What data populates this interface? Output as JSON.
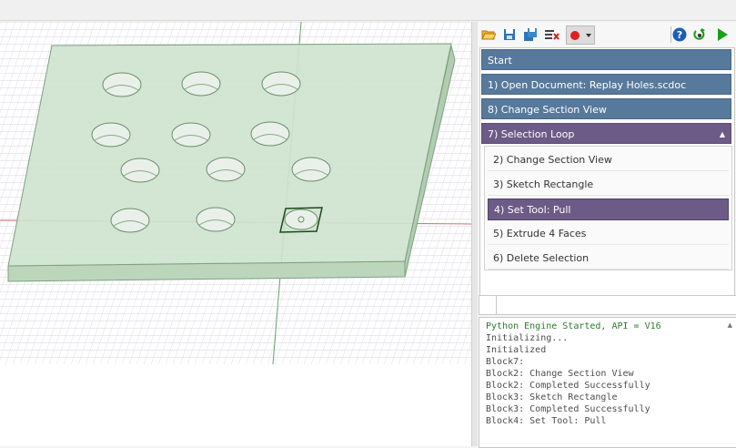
{
  "toolbar": {
    "icons": [
      "open-folder-icon",
      "save-icon",
      "save-as-icon",
      "clear-icon",
      "record-icon",
      "dropdown-icon",
      "help-icon",
      "debug-icon",
      "run-icon"
    ],
    "colors": {
      "record": "#e02020",
      "run": "#18a018",
      "help": "#1a5fb4"
    }
  },
  "steps": {
    "start": "Start",
    "open_document": "1) Open Document: Replay Holes.scdoc",
    "change_section_view": "8) Change Section View",
    "selection_loop": "7) Selection Loop",
    "selection_loop_caret": "▲"
  },
  "substeps": [
    {
      "label": "2) Change Section View",
      "selected": false
    },
    {
      "label": "3) Sketch Rectangle",
      "selected": false
    },
    {
      "label": "4) Set Tool: Pull",
      "selected": true
    },
    {
      "label": "5) Extrude 4 Faces",
      "selected": false
    },
    {
      "label": "6) Delete Selection",
      "selected": false
    }
  ],
  "console": {
    "lines": [
      "Python Engine Started, API = V16",
      "Initializing...",
      "Initialized",
      "Block7:",
      "Block2: Change Section View",
      "Block2: Completed Successfully",
      "Block3: Sketch Rectangle",
      "Block3: Completed Successfully",
      "Block4: Set Tool: Pull"
    ],
    "scroll_up": "▲"
  },
  "colors": {
    "step_blue": "#57799b",
    "step_purple": "#6c5b86",
    "plate_fill": "#cfe3cf",
    "plate_edge": "#7fa07f",
    "console_green": "#2c7a2c"
  }
}
